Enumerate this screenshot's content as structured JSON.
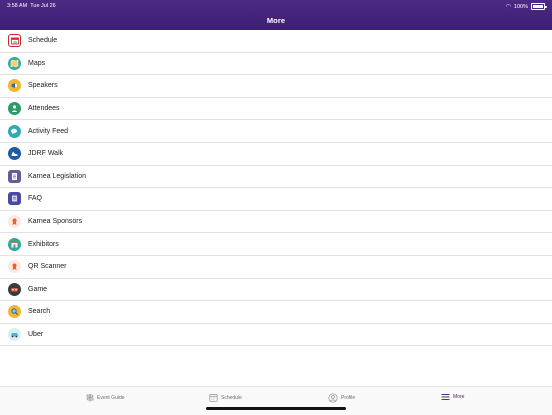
{
  "status": {
    "time": "3:58 AM",
    "date": "Tue Jul 26",
    "battery": "100%"
  },
  "header": {
    "title": "More"
  },
  "menu": [
    {
      "label": "Schedule",
      "icon": "calendar-icon",
      "color": "#c62828"
    },
    {
      "label": "Maps",
      "icon": "map-icon",
      "color": "#3aa7a0"
    },
    {
      "label": "Speakers",
      "icon": "megaphone-icon",
      "color": "#f2b631"
    },
    {
      "label": "Attendees",
      "icon": "people-icon",
      "color": "#2e9b6a"
    },
    {
      "label": "Activity Feed",
      "icon": "chat-icon",
      "color": "#2fa9b5"
    },
    {
      "label": "JDRF Walk",
      "icon": "shoe-icon",
      "color": "#1f5d9e"
    },
    {
      "label": "Karnea Legislation",
      "icon": "document-icon",
      "color": "#6a5a9a"
    },
    {
      "label": "FAQ",
      "icon": "book-icon",
      "color": "#4a4aa0"
    },
    {
      "label": "Karnea Sponsors",
      "icon": "ribbon-icon",
      "color": "#e8622c"
    },
    {
      "label": "Exhibitors",
      "icon": "booth-icon",
      "color": "#35a69a"
    },
    {
      "label": "QR Scanner",
      "icon": "qr-icon",
      "color": "#e8622c"
    },
    {
      "label": "Game",
      "icon": "gamepad-icon",
      "color": "#3b3b3b"
    },
    {
      "label": "Search",
      "icon": "magnifier-icon",
      "color": "#f2b631"
    },
    {
      "label": "Uber",
      "icon": "car-icon",
      "color": "#4cb6c9"
    }
  ],
  "tabs": [
    {
      "label": "Event Guide",
      "icon": "signpost-icon"
    },
    {
      "label": "Schedule",
      "icon": "calendar-icon"
    },
    {
      "label": "Profile",
      "icon": "user-circle-icon"
    },
    {
      "label": "More",
      "icon": "hamburger-icon",
      "active": true
    }
  ]
}
